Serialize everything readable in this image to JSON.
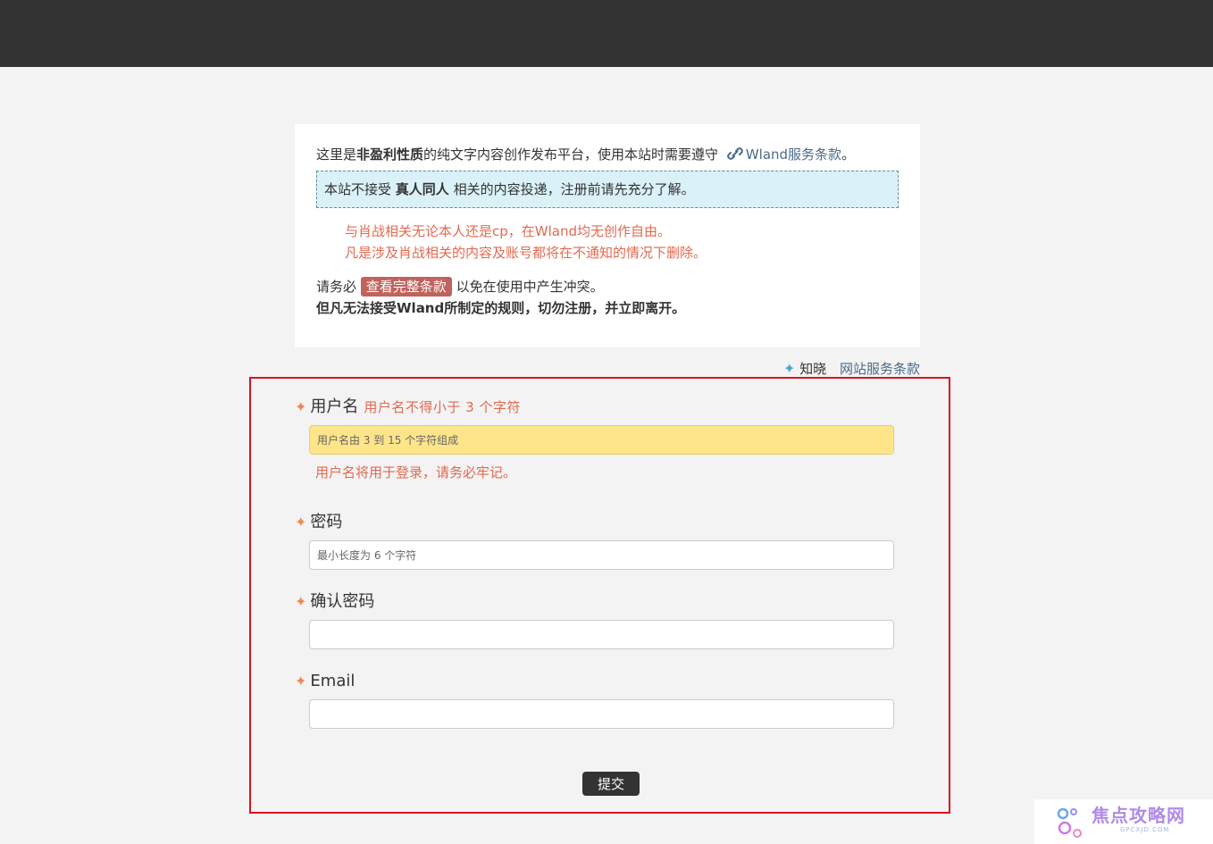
{
  "notice": {
    "intro_prefix": "这里是",
    "intro_bold": "非盈利性质",
    "intro_suffix": "的纯文字内容创作发布平台，使用本站时需要遵守",
    "tos_link": "Wland服务条款",
    "period": "。",
    "info_prefix": "本站不接受",
    "info_bold": "真人同人",
    "info_suffix": "相关的内容投递，注册前请先充分了解。",
    "warn_lines": [
      "与肖战相关无论本人还是cp，在Wland均无创作自由。",
      "凡是涉及肖战相关的内容及账号都将在不通知的情况下删除。"
    ],
    "must_prefix": "请务必",
    "full_terms_button": "查看完整条款",
    "must_suffix": "以免在使用中产生冲突。",
    "bold_line": "但凡无法接受Wland所制定的规则，切勿注册，并立即离开。"
  },
  "agree": {
    "label": "知晓",
    "link": "网站服务条款"
  },
  "form": {
    "username": {
      "label": "用户名",
      "hint": "用户名不得小于 3 个字符",
      "placeholder": "用户名由 3 到 15 个字符组成",
      "note": "用户名将用于登录，请务必牢记。"
    },
    "password": {
      "label": "密码",
      "placeholder": "最小长度为 6 个字符"
    },
    "confirm": {
      "label": "确认密码",
      "placeholder": ""
    },
    "email": {
      "label": "Email",
      "placeholder": ""
    },
    "submit_label": "提交"
  },
  "watermark": {
    "text": "焦点攻略网",
    "sub": "GPCXJD.COM"
  },
  "colors": {
    "topbar": "#333333",
    "accent_red": "#e06a50",
    "frame": "#d9121a",
    "badge": "#c0635c",
    "highlight_input": "#ffe58a",
    "info_bg": "#d9f1f7"
  }
}
